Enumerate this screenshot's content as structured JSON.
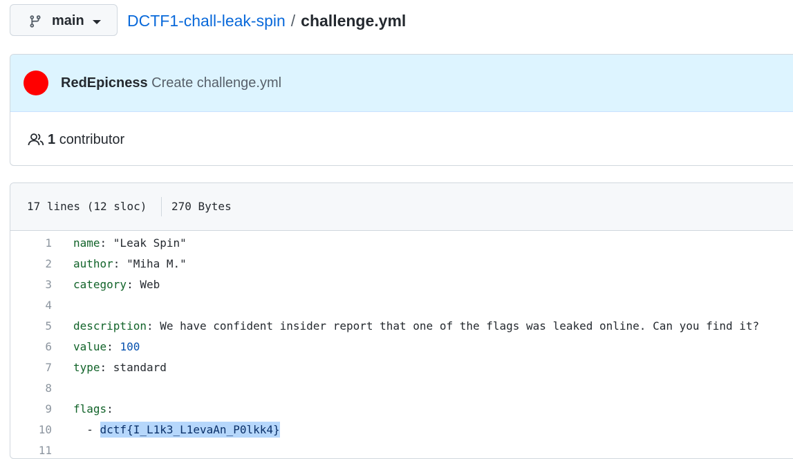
{
  "branch": {
    "name": "main",
    "icon": "git-branch-icon"
  },
  "breadcrumb": {
    "repo": "DCTF1-chall-leak-spin",
    "separator": "/",
    "file": "challenge.yml"
  },
  "commit": {
    "avatar_color": "#ff0000",
    "author": "RedEpicness",
    "message": "Create challenge.yml"
  },
  "contributors": {
    "icon": "people-icon",
    "count": "1",
    "label": "contributor"
  },
  "file_info": {
    "lines": "17 lines (12 sloc)",
    "size": "270 Bytes"
  },
  "code": [
    {
      "n": "1",
      "key": "name",
      "sep": ": ",
      "value": "\"Leak Spin\"",
      "value_type": "str"
    },
    {
      "n": "2",
      "key": "author",
      "sep": ": ",
      "value": "\"Miha M.\"",
      "value_type": "str"
    },
    {
      "n": "3",
      "key": "category",
      "sep": ": ",
      "value": "Web",
      "value_type": "str"
    },
    {
      "n": "4",
      "key": "",
      "sep": "",
      "value": "",
      "value_type": "str"
    },
    {
      "n": "5",
      "key": "description",
      "sep": ": ",
      "value": "We have confident insider report that one of the flags was leaked online. Can you find it?",
      "value_type": "str"
    },
    {
      "n": "6",
      "key": "value",
      "sep": ": ",
      "value": "100",
      "value_type": "num"
    },
    {
      "n": "7",
      "key": "type",
      "sep": ": ",
      "value": "standard",
      "value_type": "str"
    },
    {
      "n": "8",
      "key": "",
      "sep": "",
      "value": "",
      "value_type": "str"
    },
    {
      "n": "9",
      "key": "flags",
      "sep": ":",
      "value": "",
      "value_type": "str"
    },
    {
      "n": "10",
      "key": "",
      "sep": "  - ",
      "value": "dctf{I_L1k3_L1evaAn_P0lkk4}",
      "value_type": "selected"
    },
    {
      "n": "11",
      "key": "",
      "sep": "",
      "value": "",
      "value_type": "str"
    }
  ]
}
